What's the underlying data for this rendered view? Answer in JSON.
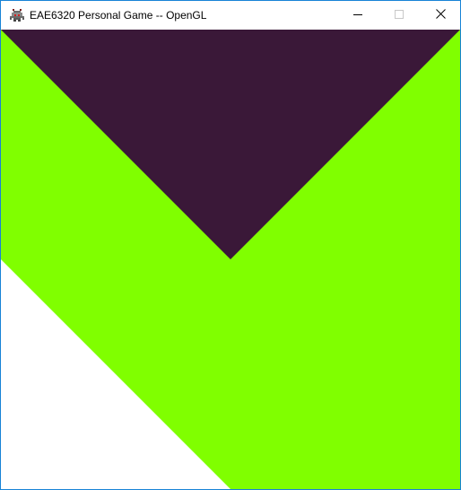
{
  "window": {
    "title": "EAE6320 Personal Game -- OpenGL",
    "app_icon": "space-invader-icon",
    "caption_buttons": {
      "minimize_icon": "minimize-icon",
      "maximize_icon": "maximize-icon",
      "close_icon": "close-icon"
    },
    "frame_color": "#1883d7"
  },
  "scene": {
    "background_color": "#ffffff",
    "green_color": "#80ff00",
    "purple_color": "#3a1838"
  }
}
